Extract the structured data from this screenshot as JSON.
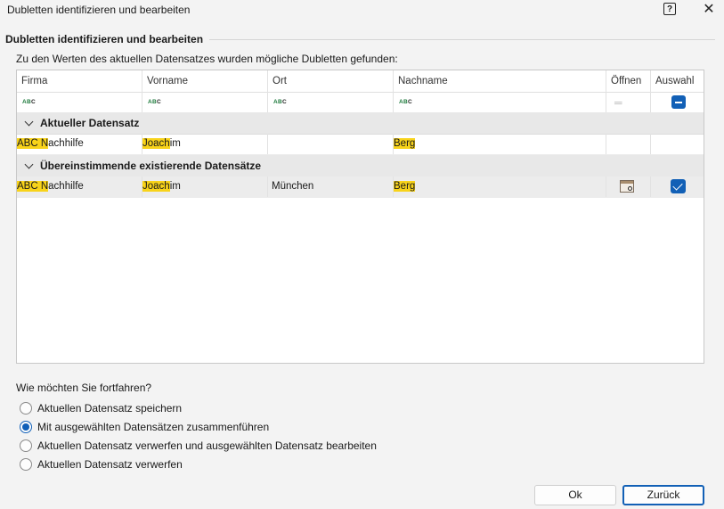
{
  "window": {
    "title": "Dubletten identifizieren und bearbeiten",
    "help_label": "?",
    "close_label": "✕"
  },
  "section": {
    "title": "Dubletten identifizieren und bearbeiten",
    "subtitle": "Zu den Werten des aktuellen Datensatzes wurden mögliche Dubletten gefunden:"
  },
  "grid": {
    "columns": [
      "Firma",
      "Vorname",
      "Ort",
      "Nachname",
      "Öffnen",
      "Auswahl"
    ],
    "filter_icon": "abc-text-filter-icon",
    "groups": [
      {
        "label": "Aktueller Datensatz",
        "rows": [
          {
            "firma": {
              "match": "ABC N",
              "rest": "achhilfe"
            },
            "vorname": {
              "match": "Joach",
              "rest": "im"
            },
            "ort": "",
            "nachname": {
              "match": "Berg",
              "rest": ""
            },
            "has_open": false,
            "has_check": false
          }
        ]
      },
      {
        "label": "Übereinstimmende existierende Datensätze",
        "rows": [
          {
            "firma": {
              "match": "ABC N",
              "rest": "achhilfe"
            },
            "vorname": {
              "match": "Joach",
              "rest": "im"
            },
            "ort": "München",
            "nachname": {
              "match": "Berg",
              "rest": ""
            },
            "has_open": true,
            "has_check": true,
            "checked": true
          }
        ]
      }
    ]
  },
  "options": {
    "question": "Wie möchten Sie fortfahren?",
    "items": [
      {
        "label": "Aktuellen Datensatz speichern",
        "selected": false
      },
      {
        "label": "Mit ausgewählten Datensätzen zusammenführen",
        "selected": true
      },
      {
        "label": "Aktuellen Datensatz verwerfen und ausgewählten Datensatz bearbeiten",
        "selected": false
      },
      {
        "label": "Aktuellen Datensatz verwerfen",
        "selected": false
      }
    ]
  },
  "buttons": {
    "ok": "Ok",
    "back": "Zurück"
  },
  "colors": {
    "accent": "#1260b6",
    "highlight": "#f8d31a"
  }
}
